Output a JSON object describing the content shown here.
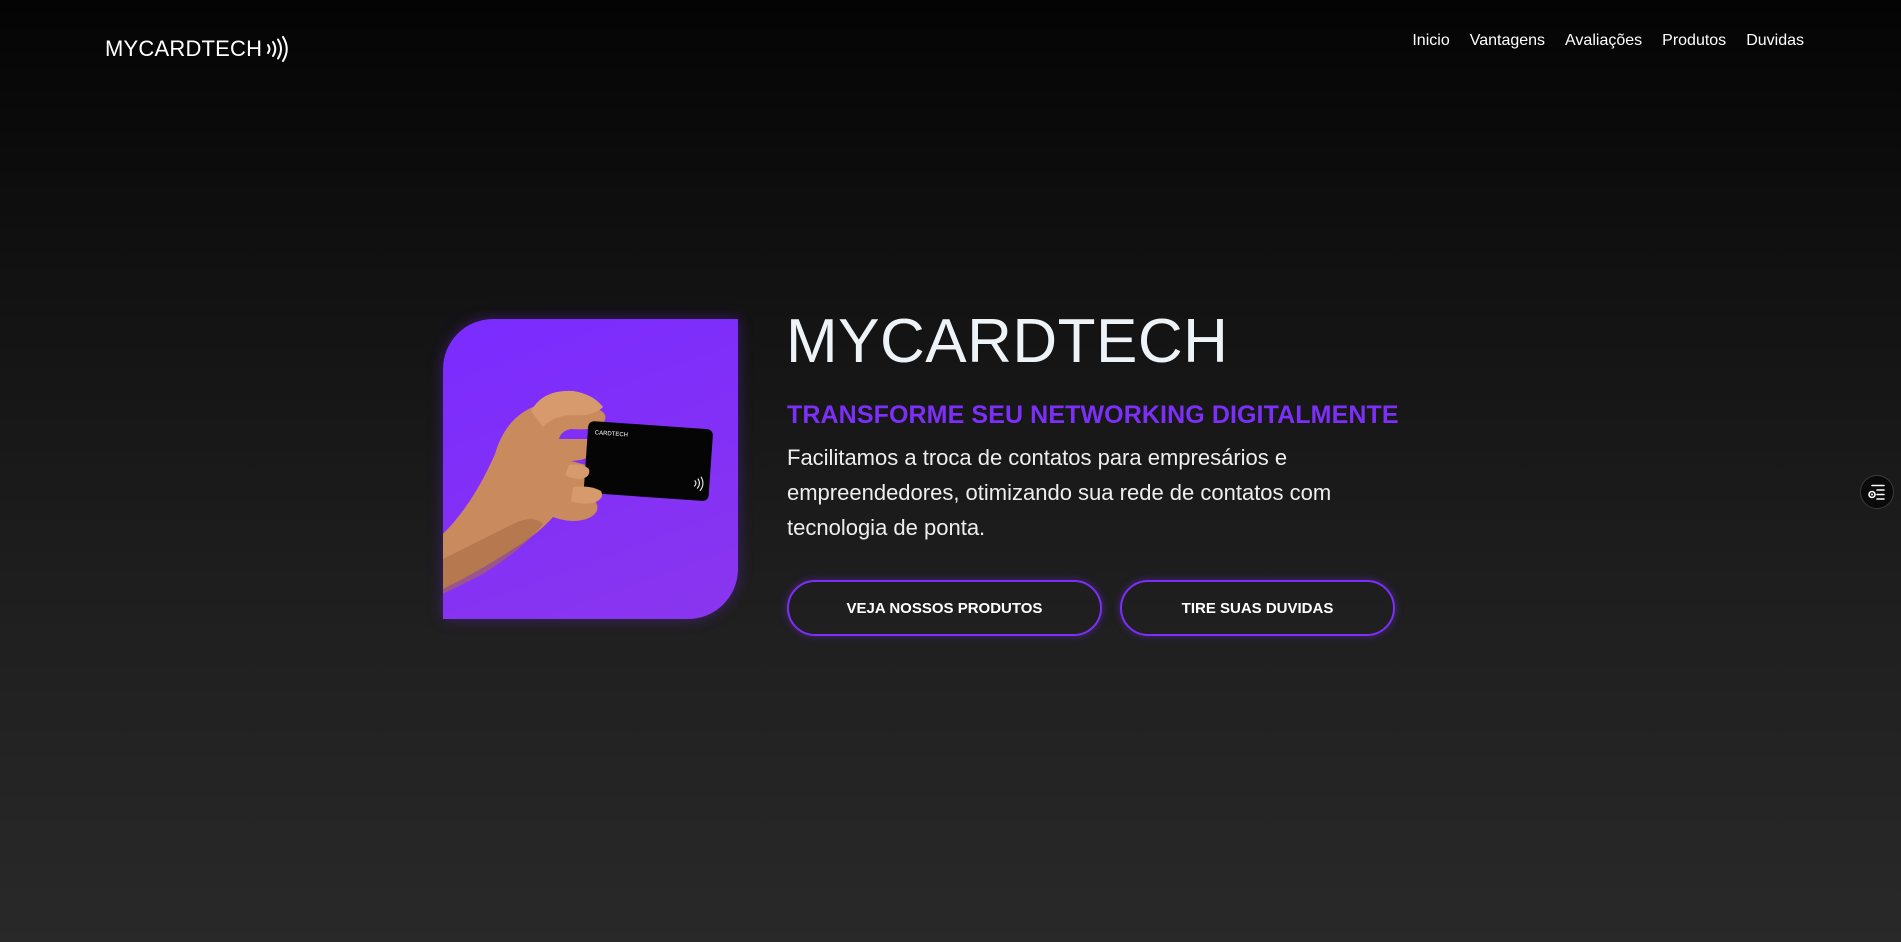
{
  "header": {
    "logo_text": "MYCARDTECH",
    "logo_icon": "nfc-waves-icon",
    "nav": [
      {
        "label": "Inicio"
      },
      {
        "label": "Vantagens"
      },
      {
        "label": "Avaliações"
      },
      {
        "label": "Produtos"
      },
      {
        "label": "Duvidas"
      }
    ]
  },
  "hero": {
    "image_card_brand": "CARDTECH",
    "title": "MYCARDTECH",
    "subtitle": "TRANSFORME SEU NETWORKING DIGITALMENTE",
    "description": "Facilitamos a troca de contatos para empresários e empreendedores, otimizando sua rede de contatos com tecnologia de ponta.",
    "buttons": {
      "products": "VEJA NOSSOS PRODUTOS",
      "faq": "TIRE SUAS DUVIDAS"
    }
  },
  "floating_widget": {
    "icon": "settings-list-icon"
  },
  "colors": {
    "accent": "#7b2ff7",
    "background_top": "#040404",
    "background_bottom": "#292929",
    "title": "#eef3f8"
  }
}
